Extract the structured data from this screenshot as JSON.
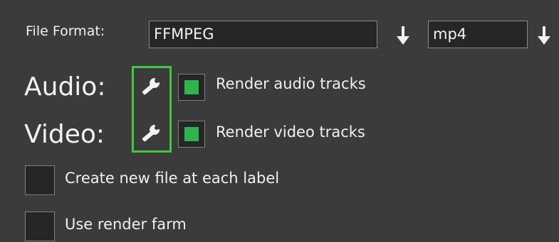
{
  "file_format": {
    "label": "File Format:",
    "format_value": "FFMPEG",
    "container_value": "mp4"
  },
  "audio": {
    "label": "Audio:",
    "checkbox_label": "Render audio tracks",
    "checked": true
  },
  "video": {
    "label": "Video:",
    "checkbox_label": "Render video tracks",
    "checked": true
  },
  "options": {
    "create_file_label": "Create new file at each label",
    "create_file_checked": false,
    "render_farm_label": "Use render farm",
    "render_farm_checked": false
  },
  "icons": {
    "dropdown": "down-arrow-icon",
    "settings": "wrench-icon"
  },
  "colors": {
    "background": "#3b3b3b",
    "check_fill": "#2fb54f",
    "focus_border": "#3fc93f"
  }
}
